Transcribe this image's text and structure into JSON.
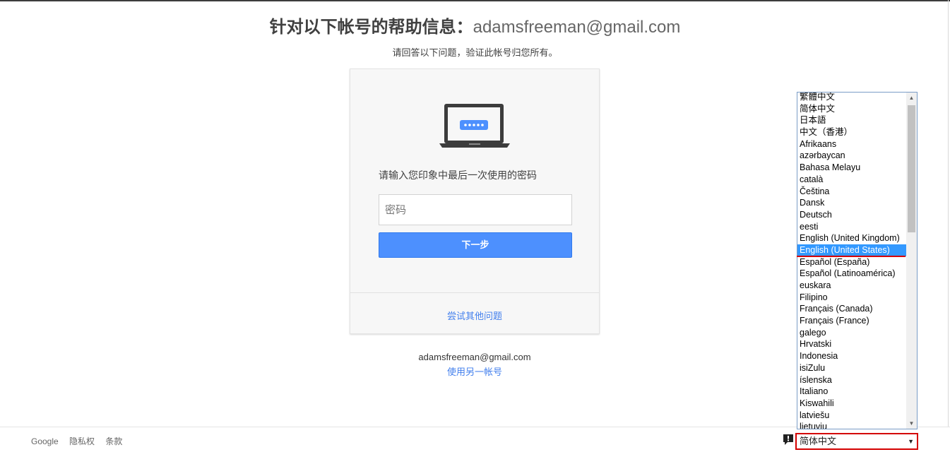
{
  "header": {
    "title_label": "针对以下帐号的帮助信息：",
    "title_email": "adamsfreeman@gmail.com",
    "subtitle": "请回答以下问题，验证此帐号归您所有。"
  },
  "card": {
    "icon": "laptop-password-icon",
    "prompt": "请输入您印象中最后一次使用的密码",
    "password_placeholder": "密码",
    "next_label": "下一步",
    "try_other_label": "尝试其他问题"
  },
  "account": {
    "email": "adamsfreeman@gmail.com",
    "use_other_label": "使用另一帐号"
  },
  "footer": {
    "links": [
      "Google",
      "隐私权",
      "条款"
    ],
    "feedback_icon": "feedback-icon"
  },
  "language": {
    "selected": "简体中文",
    "options": [
      "繁體中文",
      "简体中文",
      "日本語",
      "中文（香港）",
      "Afrikaans",
      "azərbaycan",
      "Bahasa Melayu",
      "català",
      "Čeština",
      "Dansk",
      "Deutsch",
      "eesti",
      "English (United Kingdom)",
      "English (United States)",
      "Español (España)",
      "Español (Latinoamérica)",
      "euskara",
      "Filipino",
      "Français (Canada)",
      "Français (France)",
      "galego",
      "Hrvatski",
      "Indonesia",
      "isiZulu",
      "íslenska",
      "Italiano",
      "Kiswahili",
      "latviešu",
      "lietuvių"
    ],
    "highlighted_index": 13
  },
  "colors": {
    "primary_button": "#4d90fe",
    "link": "#427fed",
    "highlight": "#3399ff",
    "annotation_red": "#d40000"
  }
}
